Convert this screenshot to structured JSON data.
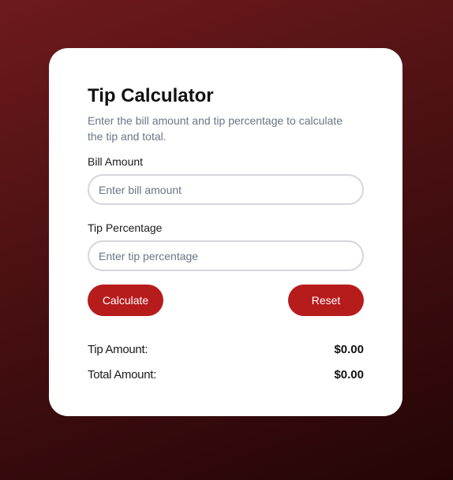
{
  "calculator": {
    "title": "Tip Calculator",
    "subtitle": "Enter the bill amount and tip percentage to calculate the tip and total.",
    "bill": {
      "label": "Bill Amount",
      "placeholder": "Enter bill amount",
      "value": ""
    },
    "tip": {
      "label": "Tip Percentage",
      "placeholder": "Enter tip percentage",
      "value": ""
    },
    "buttons": {
      "calculate": "Calculate",
      "reset": "Reset"
    },
    "results": {
      "tip_label": "Tip Amount:",
      "tip_value": "$0.00",
      "total_label": "Total Amount:",
      "total_value": "$0.00"
    }
  },
  "colors": {
    "accent": "#b71c1c",
    "background_start": "#6e1a1c",
    "background_end": "#240506",
    "card": "#ffffff",
    "subtitle_text": "#6b7486"
  }
}
